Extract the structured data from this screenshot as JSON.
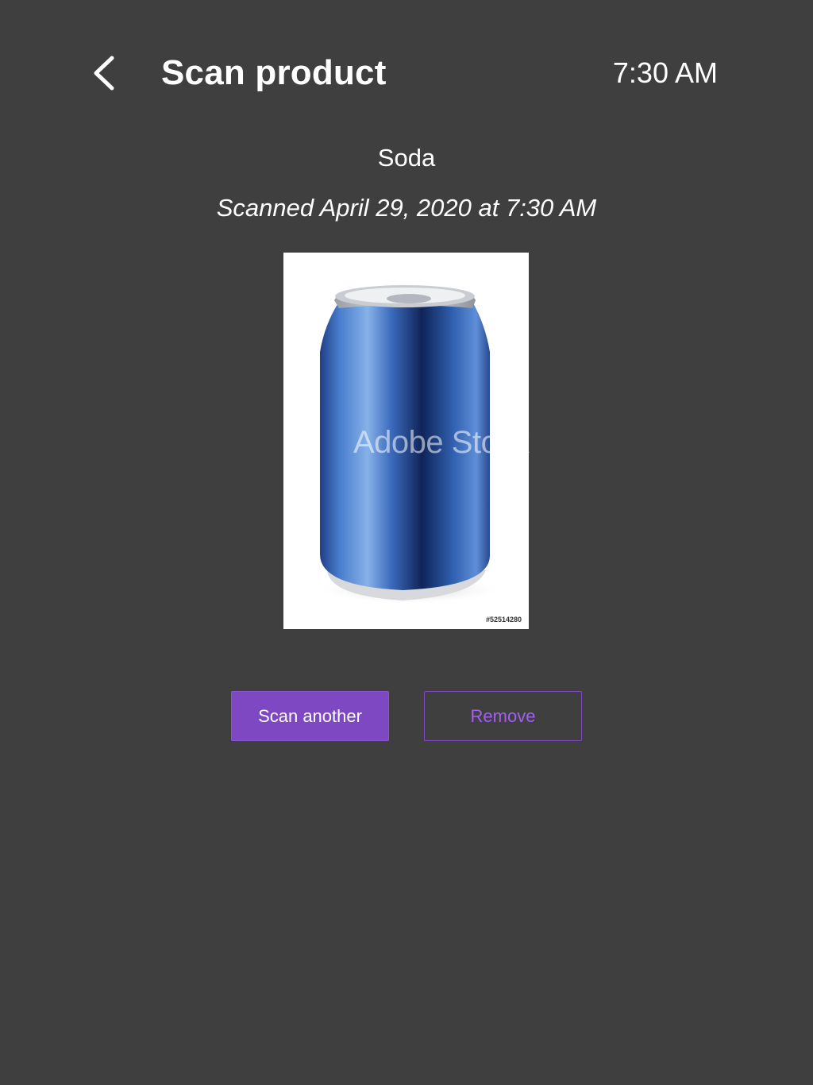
{
  "header": {
    "back_icon": "chevron-left-icon",
    "title": "Scan product",
    "time": "7:30 AM"
  },
  "product": {
    "name": "Soda",
    "scanned_label": "Scanned April 29, 2020 at 7:30 AM",
    "image": {
      "description_icon": "soda-can-image",
      "watermark": "Adobe Stock",
      "stock_id": "#52514280"
    }
  },
  "actions": {
    "scan_another_label": "Scan another",
    "remove_label": "Remove"
  },
  "colors": {
    "background": "#3f3f3f",
    "accent": "#7e48c2",
    "accent_text": "#a35ff0"
  }
}
